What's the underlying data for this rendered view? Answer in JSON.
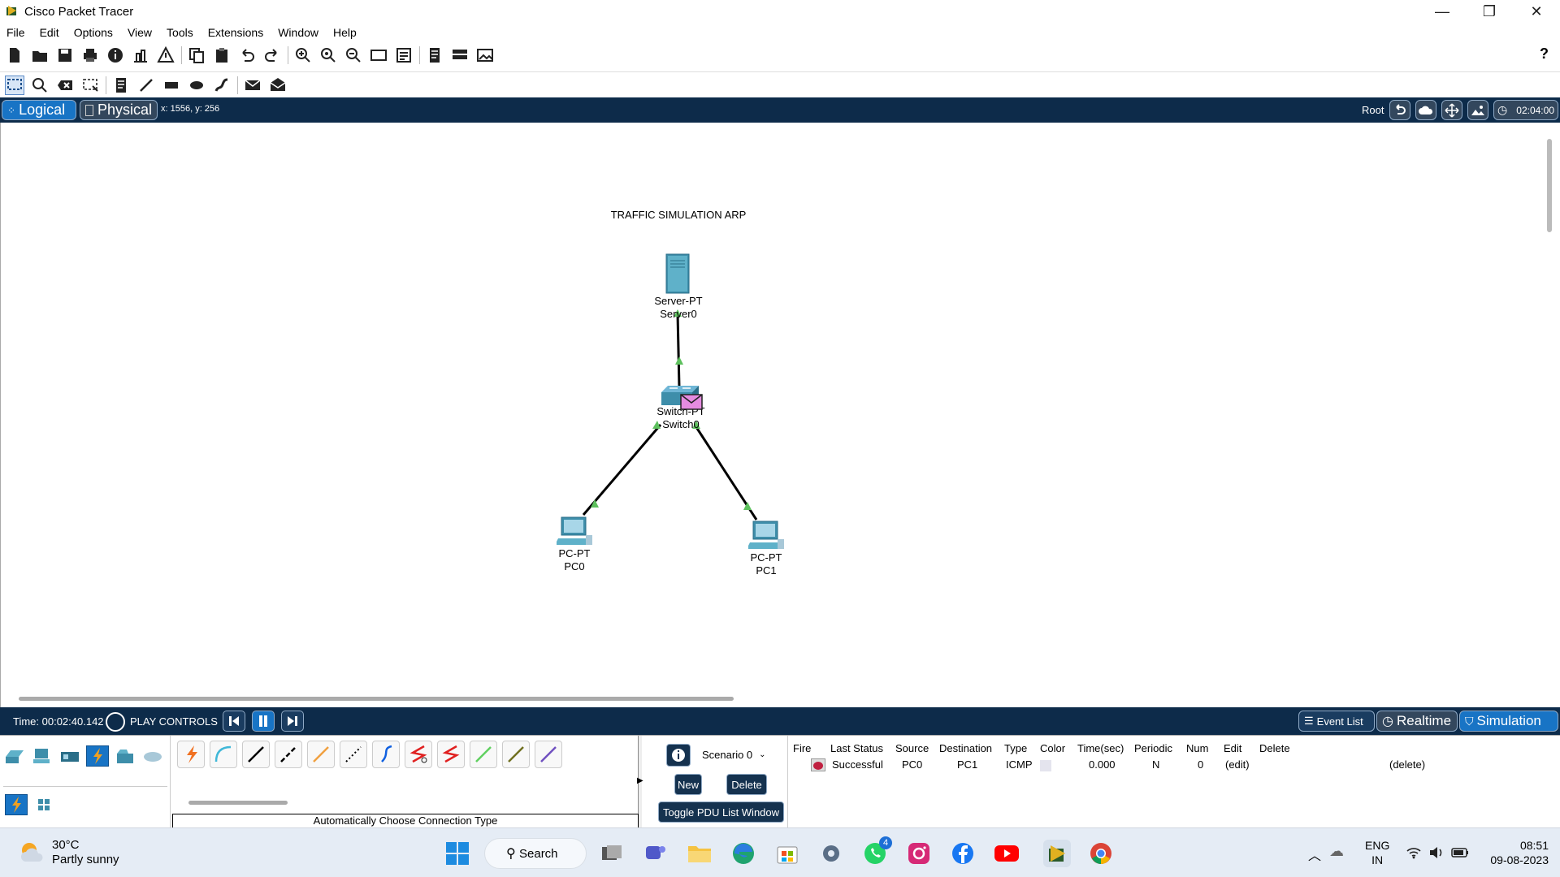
{
  "window": {
    "title": "Cisco Packet Tracer",
    "minimize": "—",
    "restore": "❐",
    "close": "✕"
  },
  "menu": [
    "File",
    "Edit",
    "Options",
    "View",
    "Tools",
    "Extensions",
    "Window",
    "Help"
  ],
  "help_label": "?",
  "logical_bar": {
    "logical_label": "Logical",
    "physical_label": "Physical",
    "coords": "x: 1556, y: 256",
    "root_label": "Root",
    "clock": "02:04:00"
  },
  "canvas": {
    "note": "TRAFFIC SIMULATION ARP",
    "devices": [
      {
        "model": "Server-PT",
        "name": "Server0"
      },
      {
        "model": "Switch-PT",
        "name": "Switch0"
      },
      {
        "model": "PC-PT",
        "name": "PC0"
      },
      {
        "model": "PC-PT",
        "name": "PC1"
      }
    ]
  },
  "sim_bar": {
    "time": "Time: 00:02:40.142",
    "play_controls": "PLAY CONTROLS",
    "event_list": "Event List",
    "realtime": "Realtime",
    "simulation": "Simulation"
  },
  "bottom": {
    "connection_status": "Automatically Choose Connection Type",
    "scenario": "Scenario 0",
    "new_label": "New",
    "delete_label": "Delete",
    "toggle_label": "Toggle PDU List Window"
  },
  "pdu_table": {
    "headers": [
      "Fire",
      "Last Status",
      "Source",
      "Destination",
      "Type",
      "Color",
      "Time(sec)",
      "Periodic",
      "Num",
      "Edit",
      "Delete"
    ],
    "rows": [
      {
        "last_status": "Successful",
        "source": "PC0",
        "destination": "PC1",
        "type": "ICMP",
        "time": "0.000",
        "periodic": "N",
        "num": "0",
        "edit": "(edit)",
        "delete": "(delete)"
      }
    ]
  },
  "taskbar": {
    "temp": "30°C",
    "weather": "Partly sunny",
    "search_label": "Search",
    "whatsapp_badge": "4",
    "lang1": "ENG",
    "lang2": "IN",
    "time": "08:51",
    "date": "09-08-2023"
  },
  "colors": {
    "accent": "#0d2b4a",
    "link_up": "#5dc05d",
    "active_blue": "#1874c5"
  }
}
